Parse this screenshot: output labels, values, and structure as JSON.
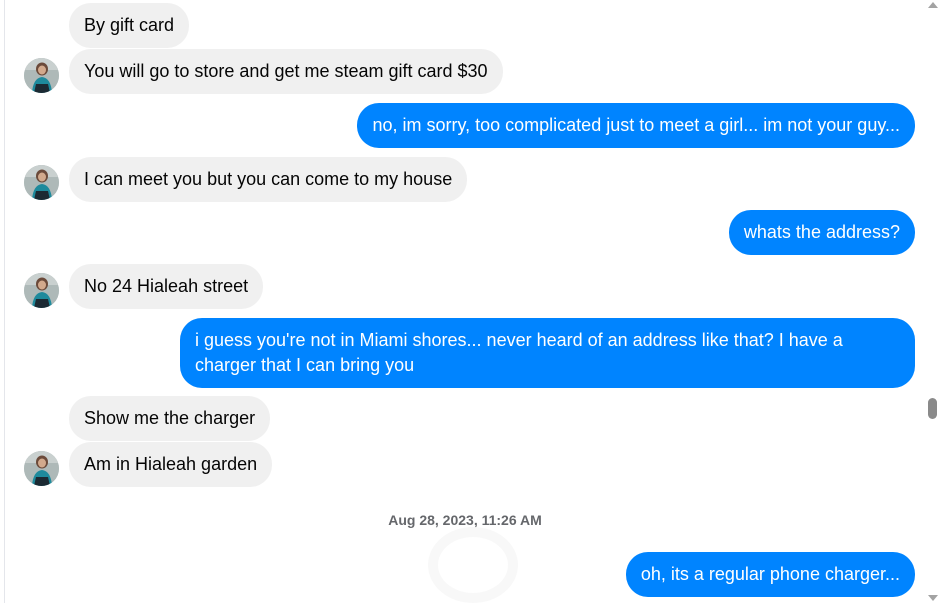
{
  "messages": [
    {
      "text": "By gift card",
      "direction": "incoming"
    },
    {
      "text": "You will go to store and get me steam gift card $30",
      "direction": "incoming"
    },
    {
      "text": "no, im sorry, too complicated just to meet a girl... im not your guy...",
      "direction": "outgoing"
    },
    {
      "text": "I can meet you but you can come to my house",
      "direction": "incoming"
    },
    {
      "text": "whats the address?",
      "direction": "outgoing"
    },
    {
      "text": "No 24  Hialeah street",
      "direction": "incoming"
    },
    {
      "text": "i guess you're  not in Miami shores...  never heard of an address like that?    I have a charger that I can bring you",
      "direction": "outgoing"
    },
    {
      "text": "Show me the charger",
      "direction": "incoming"
    },
    {
      "text": "Am in Hialeah garden",
      "direction": "incoming"
    },
    {
      "text": "oh, its a regular phone charger...",
      "direction": "outgoing"
    }
  ],
  "timestamp": "Aug 28, 2023, 11:26 AM",
  "colors": {
    "outgoing_bubble": "#0084ff",
    "incoming_bubble": "#f0f0f0",
    "timestamp_text": "#65676b"
  }
}
